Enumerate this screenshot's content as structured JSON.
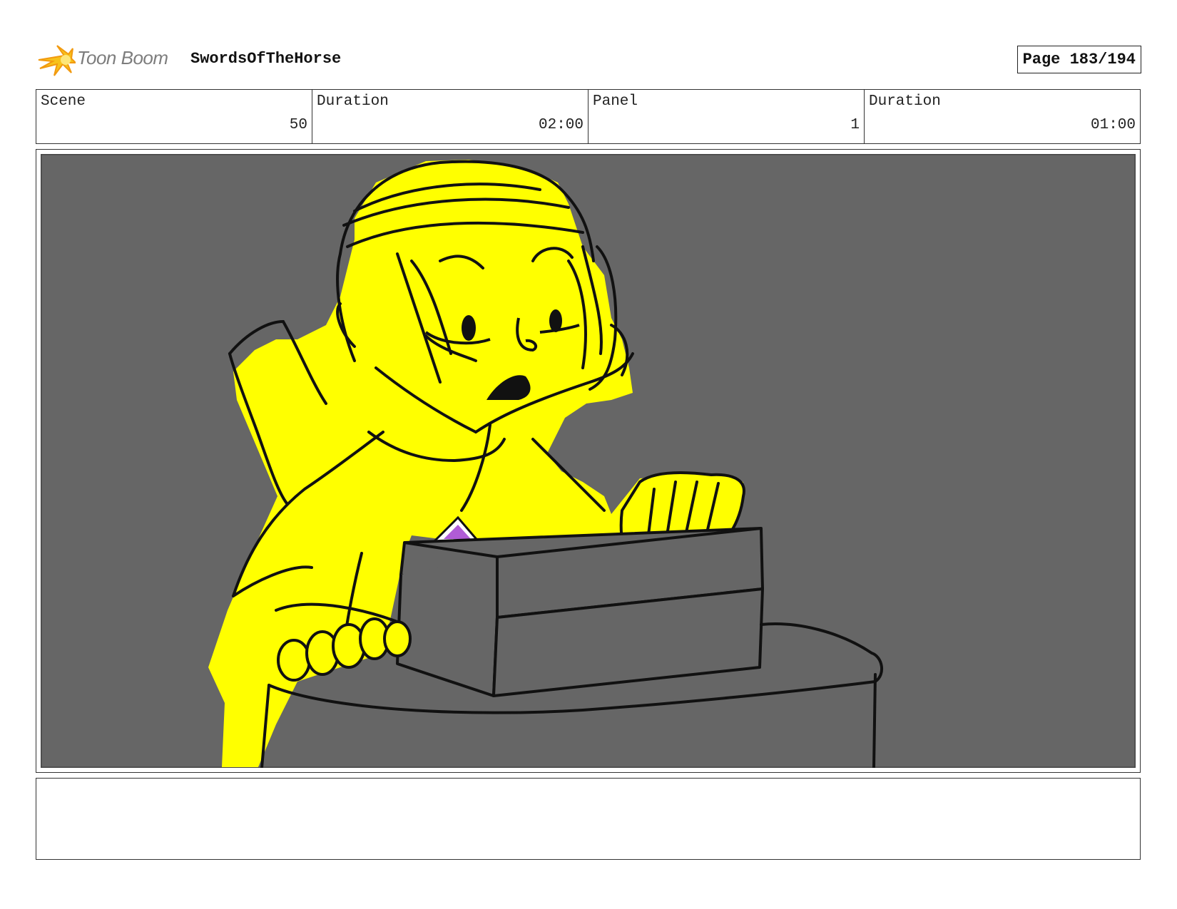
{
  "header": {
    "logo_text": "Toon Boom",
    "project_title": "SwordsOfTheHorse",
    "page_label": "Page 183/194"
  },
  "info": [
    {
      "label": "Scene",
      "value": "50"
    },
    {
      "label": "Duration",
      "value": "02:00"
    },
    {
      "label": "Panel",
      "value": "1"
    },
    {
      "label": "Duration",
      "value": "01:00"
    }
  ],
  "panel": {
    "image_kind": "storyboard sketch",
    "colors": {
      "background": "#666666",
      "figure": "#ffff00",
      "gem": "#b05cd6",
      "ink": "#111111"
    }
  },
  "caption": {
    "text": ""
  }
}
